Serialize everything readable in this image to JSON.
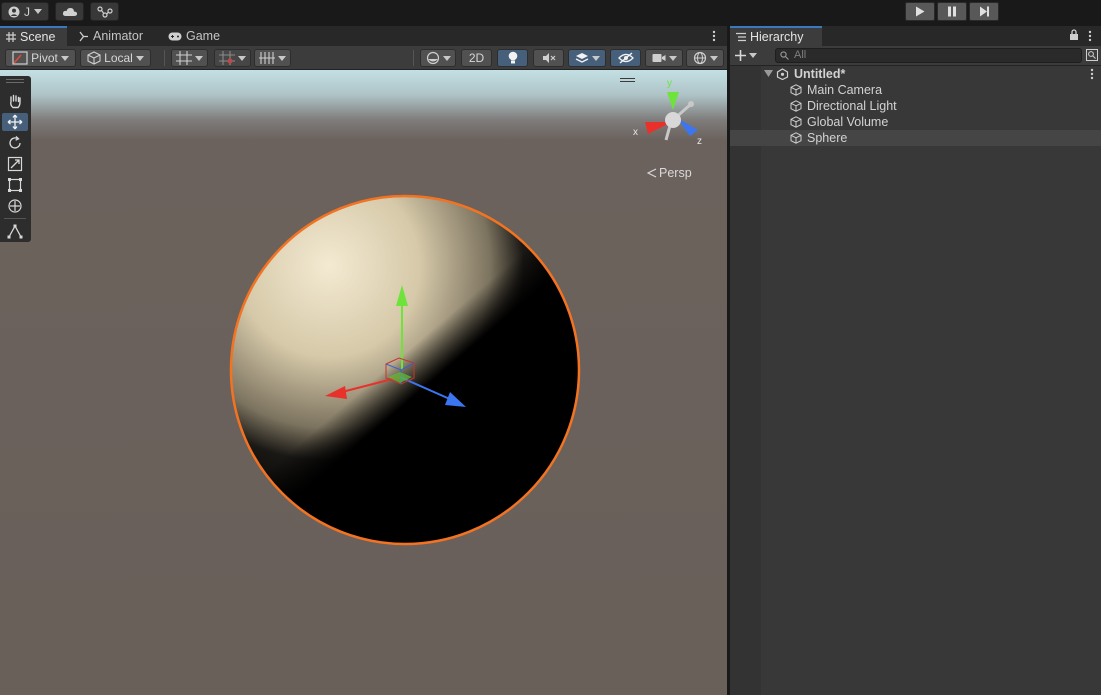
{
  "toolbar": {
    "account_label": "J",
    "cloud_icon": "cloud-icon",
    "collab_icon": "share-icon"
  },
  "scene_tabs": [
    {
      "label": "Scene",
      "icon": "grid-icon"
    },
    {
      "label": "Animator",
      "icon": "animator-icon"
    },
    {
      "label": "Game",
      "icon": "gamepad-icon"
    }
  ],
  "scene_toolbar": {
    "pivot_label": "Pivot",
    "local_label": "Local",
    "mode_2d_label": "2D"
  },
  "viewport": {
    "persp_label": "Persp",
    "gizmo_x": "x",
    "gizmo_y": "y",
    "gizmo_z": "z",
    "selection_color": "#f37321",
    "axis_colors": {
      "x": "#e8312b",
      "y": "#6ee33b",
      "z": "#3b76f0"
    }
  },
  "hierarchy": {
    "tab_label": "Hierarchy",
    "search_placeholder": "All",
    "scene_name": "Untitled*",
    "items": [
      {
        "label": "Main Camera"
      },
      {
        "label": "Directional Light"
      },
      {
        "label": "Global Volume"
      },
      {
        "label": "Sphere"
      }
    ],
    "selected_item": "Sphere"
  },
  "colors": {
    "accent": "#3a79bb",
    "panel": "#383838",
    "toolbar": "#3c3c3c"
  }
}
